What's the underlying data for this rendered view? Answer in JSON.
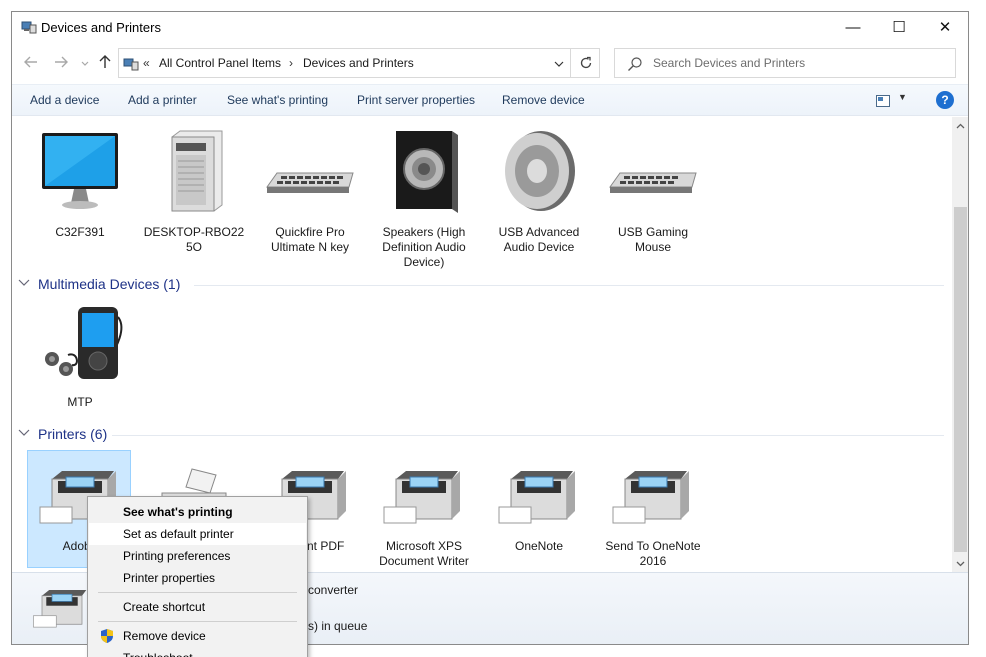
{
  "window": {
    "title": "Devices and Printers",
    "controls": {
      "minimize": "—",
      "maximize": "☐",
      "close": "✕"
    }
  },
  "address": {
    "overflow": "«",
    "crumbs": [
      "All Control Panel Items",
      "Devices and Printers"
    ],
    "separator": "›"
  },
  "search": {
    "placeholder": "Search Devices and Printers"
  },
  "commands": [
    "Add a device",
    "Add a printer",
    "See what's printing",
    "Print server properties",
    "Remove device"
  ],
  "help_label": "?",
  "devices": [
    {
      "label": "C32F391",
      "icon": "monitor-icon"
    },
    {
      "label": "DESKTOP-RBO22 5O",
      "icon": "computer-tower-icon"
    },
    {
      "label": "Quickfire Pro Ultimate N key",
      "icon": "keyboard-icon"
    },
    {
      "label": "Speakers (High Definition Audio Device)",
      "icon": "speaker-icon"
    },
    {
      "label": "USB Advanced Audio Device",
      "icon": "speaker-round-icon"
    },
    {
      "label": "USB Gaming Mouse",
      "icon": "keyboard-icon"
    }
  ],
  "multimedia": {
    "header": "Multimedia Devices (1)",
    "items": [
      {
        "label": "MTP",
        "icon": "media-player-icon"
      }
    ]
  },
  "printers": {
    "header": "Printers (6)",
    "items": [
      {
        "label": "Adobe",
        "icon": "printer-icon"
      },
      {
        "label": "",
        "icon": "fax-icon"
      },
      {
        "label": "oft Print PDF",
        "icon": "printer-icon"
      },
      {
        "label": "Microsoft XPS Document Writer",
        "icon": "printer-icon"
      },
      {
        "label": "OneNote",
        "icon": "printer-icon"
      },
      {
        "label": "Send To OneNote 2016",
        "icon": "printer-icon"
      }
    ]
  },
  "details": {
    "line1": "converter",
    "line2": "s) in queue"
  },
  "context_menu": {
    "items": [
      {
        "label": "See what's printing",
        "bold": true
      },
      {
        "label": "Set as default printer",
        "hover": true
      },
      {
        "label": "Printing preferences"
      },
      {
        "label": "Printer properties"
      },
      {
        "label": "Create shortcut"
      },
      {
        "label": "Remove device",
        "icon": "shield-icon"
      },
      {
        "label": "Troubleshoot"
      }
    ]
  },
  "colors": {
    "accent": "#1e6fd0",
    "selection": "#cce8ff",
    "group_header": "#1e3287"
  }
}
